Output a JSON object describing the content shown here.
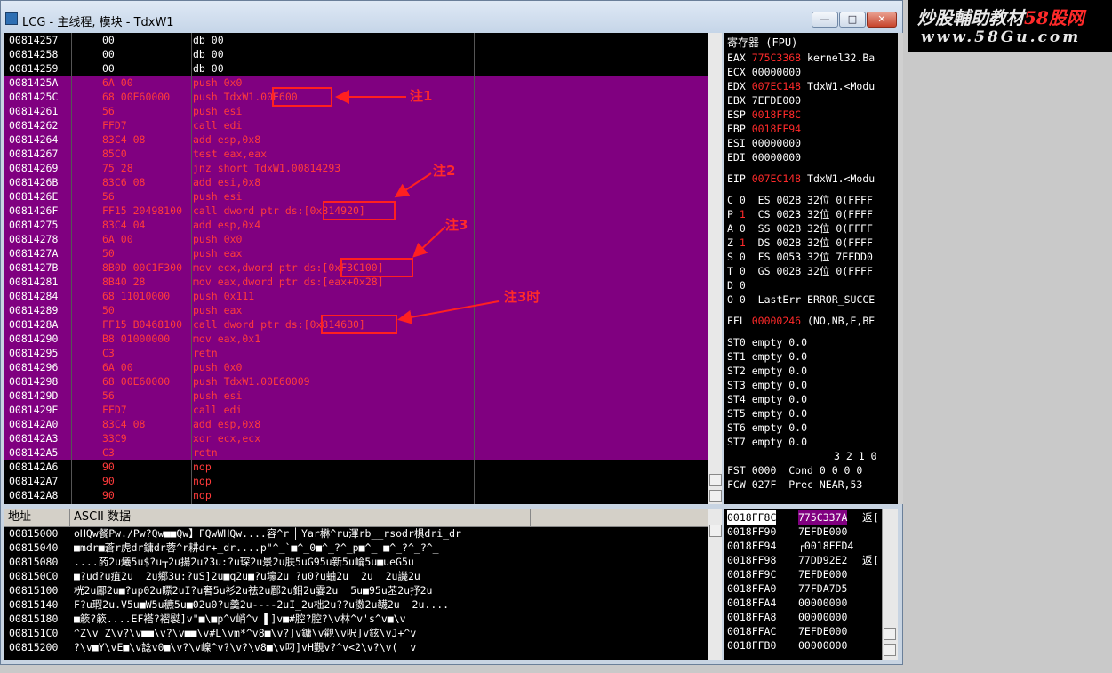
{
  "window": {
    "title": "LCG - 主线程, 模块 - TdxW1",
    "min_label": "—",
    "max_label": "□",
    "close_label": "✕"
  },
  "logo": {
    "line1": "炒股輔助教材",
    "line1_red": "58股网",
    "line2": "www.58Gu.com"
  },
  "colors": {
    "highlight": "#800080",
    "annot": "#ff2020"
  },
  "disasm": [
    {
      "addr": "00814257",
      "hex": "00",
      "dis": "db 00",
      "hl": false
    },
    {
      "addr": "00814258",
      "hex": "00",
      "dis": "db 00",
      "hl": false
    },
    {
      "addr": "00814259",
      "hex": "00",
      "dis": "db 00",
      "hl": false
    },
    {
      "addr": "0081425A",
      "hex": "6A 00",
      "dis": "push 0x0",
      "hl": true
    },
    {
      "addr": "0081425C",
      "hex": "68 00E60000",
      "dis": "push TdxW1.00E600",
      "hl": true
    },
    {
      "addr": "00814261",
      "hex": "56",
      "dis": "push esi",
      "hl": true
    },
    {
      "addr": "00814262",
      "hex": "FFD7",
      "dis": "call edi",
      "hl": true
    },
    {
      "addr": "00814264",
      "hex": "83C4 08",
      "dis": "add esp,0x8",
      "hl": true
    },
    {
      "addr": "00814267",
      "hex": "85C0",
      "dis": "test eax,eax",
      "hl": true
    },
    {
      "addr": "00814269",
      "hex": "75 28",
      "dis": "jnz short TdxW1.00814293",
      "hl": true
    },
    {
      "addr": "0081426B",
      "hex": "83C6 08",
      "dis": "add esi,0x8",
      "hl": true
    },
    {
      "addr": "0081426E",
      "hex": "56",
      "dis": "push esi",
      "hl": true
    },
    {
      "addr": "0081426F",
      "hex": "FF15 20498100",
      "dis": "call dword ptr ds:[0x814920]",
      "hl": true
    },
    {
      "addr": "00814275",
      "hex": "83C4 04",
      "dis": "add esp,0x4",
      "hl": true
    },
    {
      "addr": "00814278",
      "hex": "6A 00",
      "dis": "push 0x0",
      "hl": true
    },
    {
      "addr": "0081427A",
      "hex": "50",
      "dis": "push eax",
      "hl": true
    },
    {
      "addr": "0081427B",
      "hex": "8B0D 00C1F300",
      "dis": "mov ecx,dword ptr ds:[0xF3C100]",
      "hl": true
    },
    {
      "addr": "00814281",
      "hex": "8B40 28",
      "dis": "mov eax,dword ptr ds:[eax+0x28]",
      "hl": true
    },
    {
      "addr": "00814284",
      "hex": "68 11010000",
      "dis": "push 0x111",
      "hl": true
    },
    {
      "addr": "00814289",
      "hex": "50",
      "dis": "push eax",
      "hl": true
    },
    {
      "addr": "0081428A",
      "hex": "FF15 B0468100",
      "dis": "call dword ptr ds:[0x8146B0]",
      "hl": true
    },
    {
      "addr": "00814290",
      "hex": "B8 01000000",
      "dis": "mov eax,0x1",
      "hl": true
    },
    {
      "addr": "00814295",
      "hex": "C3",
      "dis": "retn",
      "hl": true
    },
    {
      "addr": "00814296",
      "hex": "6A 00",
      "dis": "push 0x0",
      "hl": true
    },
    {
      "addr": "00814298",
      "hex": "68 00E60000",
      "dis": "push TdxW1.00E60009",
      "hl": true
    },
    {
      "addr": "0081429D",
      "hex": "56",
      "dis": "push esi",
      "hl": true
    },
    {
      "addr": "0081429E",
      "hex": "FFD7",
      "dis": "call edi",
      "hl": true
    },
    {
      "addr": "008142A0",
      "hex": "83C4 08",
      "dis": "add esp,0x8",
      "hl": true
    },
    {
      "addr": "008142A3",
      "hex": "33C9",
      "dis": "xor ecx,ecx",
      "hl": true
    },
    {
      "addr": "008142A5",
      "hex": "C3",
      "dis": "retn",
      "hl": true
    },
    {
      "addr": "008142A6",
      "hex": "90",
      "dis": "nop",
      "hl": false
    },
    {
      "addr": "008142A7",
      "hex": "90",
      "dis": "nop",
      "hl": false
    },
    {
      "addr": "008142A8",
      "hex": "90",
      "dis": "nop",
      "hl": false
    }
  ],
  "annotations": {
    "a1": {
      "box": "0x00E6000",
      "label": "注1"
    },
    "a2": {
      "box": "0x814920]",
      "label": "注2"
    },
    "a3": {
      "box": "0xF3C100]",
      "label": "注3"
    },
    "a4": {
      "box": "0x8146B0]",
      "label": "注3时"
    }
  },
  "regs": {
    "header": "寄存器 (FPU)",
    "lines": [
      {
        "n": "EAX",
        "v": "775C3368",
        "c": "kernel32.Ba",
        "red": true
      },
      {
        "n": "ECX",
        "v": "00000000",
        "c": "",
        "red": false
      },
      {
        "n": "EDX",
        "v": "007EC148",
        "c": "TdxW1.<Modu",
        "red": true
      },
      {
        "n": "EBX",
        "v": "7EFDE000",
        "c": "",
        "red": false
      },
      {
        "n": "ESP",
        "v": "0018FF8C",
        "c": "",
        "red": true
      },
      {
        "n": "EBP",
        "v": "0018FF94",
        "c": "",
        "red": true
      },
      {
        "n": "ESI",
        "v": "00000000",
        "c": "",
        "red": false
      },
      {
        "n": "EDI",
        "v": "00000000",
        "c": "",
        "red": false
      },
      {
        "n": "",
        "v": "",
        "c": "",
        "red": false
      },
      {
        "n": "EIP",
        "v": "007EC148",
        "c": "TdxW1.<Modu",
        "red": true
      }
    ],
    "flags": [
      {
        "f": "C",
        "b": "0",
        "seg": "ES 002B 32位 0(FFFF",
        "red": false
      },
      {
        "f": "P",
        "b": "1",
        "seg": "CS 0023 32位 0(FFFF",
        "red": true
      },
      {
        "f": "A",
        "b": "0",
        "seg": "SS 002B 32位 0(FFFF",
        "red": false
      },
      {
        "f": "Z",
        "b": "1",
        "seg": "DS 002B 32位 0(FFFF",
        "red": true
      },
      {
        "f": "S",
        "b": "0",
        "seg": "FS 0053 32位 7EFDD0",
        "red": false
      },
      {
        "f": "T",
        "b": "0",
        "seg": "GS 002B 32位 0(FFFF",
        "red": false
      },
      {
        "f": "D",
        "b": "0",
        "seg": "",
        "red": false
      },
      {
        "f": "O",
        "b": "0",
        "seg": "LastErr ERROR_SUCCE",
        "red": false
      }
    ],
    "efl": {
      "n": "EFL",
      "v": "00000246",
      "c": "(NO,NB,E,BE"
    },
    "st": [
      "ST0 empty 0.0",
      "ST1 empty 0.0",
      "ST2 empty 0.0",
      "ST3 empty 0.0",
      "ST4 empty 0.0",
      "ST5 empty 0.0",
      "ST6 empty 0.0",
      "ST7 empty 0.0"
    ],
    "fpu_bits": "3 2 1 0",
    "fst": "FST 0000  Cond 0 0 0 0",
    "fcw": "FCW 027F  Prec NEAR,53"
  },
  "dump": {
    "col_addr": "地址",
    "col_data": "ASCII 数据",
    "rows": [
      {
        "a": "00815000",
        "t": "oHQw餐Pw./Pw?Qw■■Qw】FQwWHQw....容^r ▏Yar楙^ru渾rb__rsodr椇dri_dr"
      },
      {
        "a": "00815040",
        "t": "■mdr■蒼r虎dr鏞dr蓉^r耕dr+_dr....p\"^_`■^_0■^_?^_p■^_ ■^_?^_?^_"
      },
      {
        "a": "00815080",
        "t": "....菂2u爔5u$?u╥2u揚2u?3u:?u琛2u景2u肤5uG95u新5u崘5u■ueG5u"
      },
      {
        "a": "008150C0",
        "t": "■?ud?u疽2u  2u鄉3u:?uS]2u■q2u■?u壕2u ?u0?u蛐2u  2u  2u譏2u"
      },
      {
        "a": "00815100",
        "t": "桄2u鄘2u■?up02u瞟2uI?u奢5u衫2u祛2u郿2u鉬2u霎2u  5u■95u苤2u抒2u"
      },
      {
        "a": "00815140",
        "t": "F?u瑕2u.V5u■W5u穮5u■02u0?u羹2u----2uI_2u柮2u??u擞2u韤2u  2u...."
      },
      {
        "a": "00815180",
        "t": "■簌?簌....EF褡?褶褽]v\"■\\■p^v峭^v ▌]v■#腔?腔?\\v林^v's^v■\\v"
      },
      {
        "a": "008151C0",
        "t": "^Z\\v Z\\v?\\v■■\\v?\\v■■\\v#L\\vm*^v8■\\v?]v鏞\\v觀\\v呎]v鉉\\vJ+^v"
      },
      {
        "a": "00815200",
        "t": "?\\v■Y\\vE■\\v諗v0■\\v?\\v嵲^v?\\v?\\v8■\\v叼]vH覲v?^v<2\\v?\\v(  v"
      }
    ]
  },
  "stack": [
    {
      "a": "0018FF8C",
      "v": "775C337A",
      "c": "返[",
      "sel": true
    },
    {
      "a": "0018FF90",
      "v": "7EFDE000",
      "c": "",
      "sel": false
    },
    {
      "a": "0018FF94",
      "v": "┌0018FFD4",
      "c": "",
      "sel": false
    },
    {
      "a": "0018FF98",
      "v": "77DD92E2",
      "c": "返[",
      "sel": false
    },
    {
      "a": "0018FF9C",
      "v": "7EFDE000",
      "c": "",
      "sel": false
    },
    {
      "a": "0018FFA0",
      "v": "77FDA7D5",
      "c": "",
      "sel": false
    },
    {
      "a": "0018FFA4",
      "v": "00000000",
      "c": "",
      "sel": false
    },
    {
      "a": "0018FFA8",
      "v": "00000000",
      "c": "",
      "sel": false
    },
    {
      "a": "0018FFAC",
      "v": "7EFDE000",
      "c": "",
      "sel": false
    },
    {
      "a": "0018FFB0",
      "v": "00000000",
      "c": "",
      "sel": false
    }
  ]
}
